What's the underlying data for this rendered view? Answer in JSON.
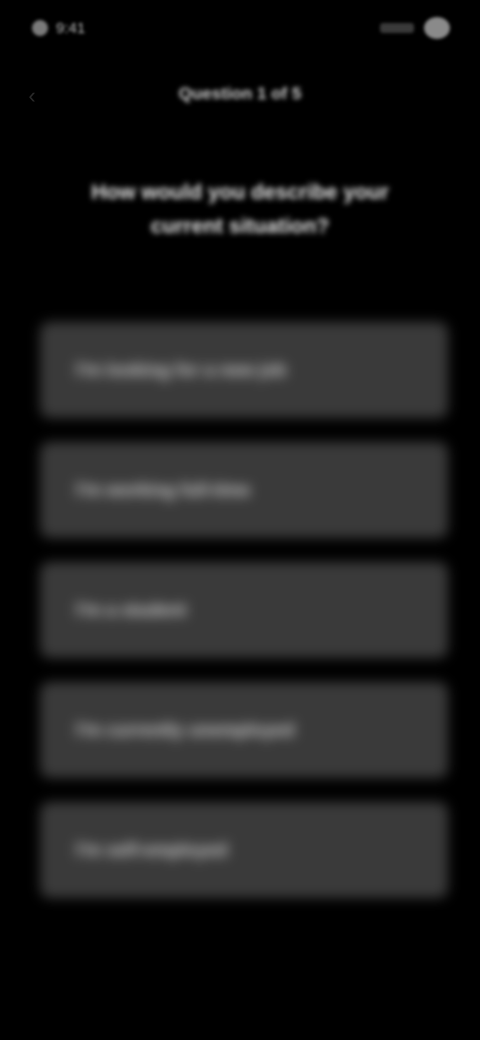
{
  "status_bar": {
    "time": "9:41"
  },
  "header": {
    "back_icon": "chevron-left-icon",
    "title": "Question 1 of 5"
  },
  "question": {
    "text": "How would you describe your current situation?"
  },
  "options": [
    {
      "label": "I'm looking for a new job"
    },
    {
      "label": "I'm working full-time"
    },
    {
      "label": "I'm a student"
    },
    {
      "label": "I'm currently unemployed"
    },
    {
      "label": "I'm self-employed"
    }
  ],
  "colors": {
    "background": "#000000",
    "card": "#3a3a3a",
    "text": "#e6e6e6"
  }
}
